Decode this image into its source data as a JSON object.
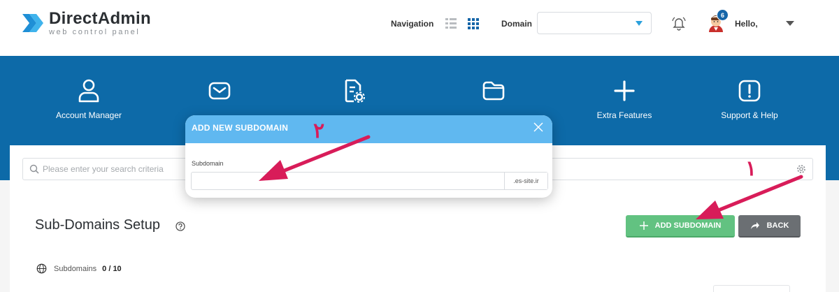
{
  "header": {
    "logo_title": "DirectAdmin",
    "logo_subtitle": "web control panel",
    "navigation_label": "Navigation",
    "domain_label": "Domain",
    "domain_value": "",
    "notification_count": "6",
    "greeting": "Hello,"
  },
  "menu": [
    {
      "label": "Account Manager",
      "icon": "user-icon"
    },
    {
      "label": "",
      "icon": "mail-icon"
    },
    {
      "label": "",
      "icon": "file-settings-icon"
    },
    {
      "label": "",
      "icon": "folder-icon"
    },
    {
      "label": "Extra Features",
      "icon": "plus-icon"
    },
    {
      "label": "Support & Help",
      "icon": "alert-icon"
    }
  ],
  "search": {
    "placeholder": "Please enter your search criteria"
  },
  "page": {
    "title": "Sub-Domains Setup",
    "add_button": "ADD SUBDOMAIN",
    "back_button": "BACK",
    "subdomains_label": "Subdomains",
    "subdomains_count": "0 / 10"
  },
  "modal": {
    "title": "ADD NEW SUBDOMAIN",
    "field_label": "Subdomain",
    "field_value": "",
    "domain_suffix": ".es-site.ir"
  },
  "annotations": {
    "step1": "۱",
    "step2": "۲",
    "arrow_color": "#d81c59"
  },
  "colors": {
    "band": "#0d6aa8",
    "modal_header": "#60b8f0",
    "add_button": "#62c281",
    "back_button": "#6b6f73"
  }
}
